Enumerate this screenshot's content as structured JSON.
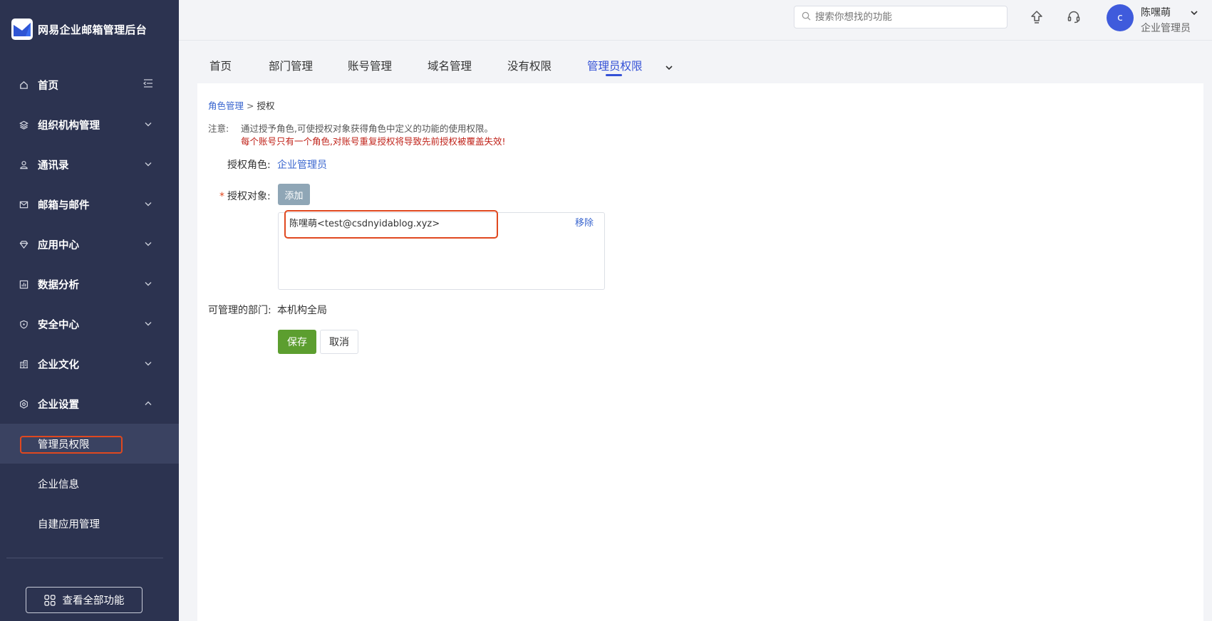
{
  "sidebar": {
    "brand_name": "网易企业邮箱管理后台",
    "items": [
      {
        "label": "首页",
        "icon": "home-icon"
      },
      {
        "label": "组织机构管理",
        "icon": "org-icon"
      },
      {
        "label": "通讯录",
        "icon": "contacts-icon"
      },
      {
        "label": "邮箱与邮件",
        "icon": "mail-icon"
      },
      {
        "label": "应用中心",
        "icon": "app-icon"
      },
      {
        "label": "数据分析",
        "icon": "chart-icon"
      },
      {
        "label": "安全中心",
        "icon": "shield-icon"
      },
      {
        "label": "企业文化",
        "icon": "building-icon"
      },
      {
        "label": "企业设置",
        "icon": "settings-icon"
      }
    ],
    "sub_items": [
      {
        "label": "管理员权限"
      },
      {
        "label": "企业信息"
      },
      {
        "label": "自建应用管理"
      }
    ],
    "view_all_label": "查看全部功能"
  },
  "header": {
    "search_placeholder": "搜索你想找的功能",
    "avatar_letter": "c",
    "user_name": "陈嘿萌",
    "user_role": "企业管理员"
  },
  "tabs": [
    {
      "label": "首页"
    },
    {
      "label": "部门管理"
    },
    {
      "label": "账号管理"
    },
    {
      "label": "域名管理"
    },
    {
      "label": "没有权限"
    },
    {
      "label": "管理员权限"
    }
  ],
  "content": {
    "breadcrumb_parent": "角色管理",
    "breadcrumb_sep": ">",
    "breadcrumb_current": "授权",
    "note_label": "注意:",
    "note_line1": "通过授予角色,可使授权对象获得角色中定义的功能的使用权限。",
    "note_line2": "每个账号只有一个角色,对账号重复授权将导致先前授权被覆盖失效!",
    "role_label": "授权角色:",
    "role_value": "企业管理员",
    "required_mark": "*",
    "target_label": "授权对象:",
    "add_button": "添加",
    "target_entry": "陈嘿萌<test@csdnyidablog.xyz>",
    "remove_label": "移除",
    "dept_label": "可管理的部门:",
    "dept_value": "本机构全局",
    "save_button": "保存",
    "cancel_button": "取消"
  },
  "colors": {
    "sidebar_bg": "#2c3350",
    "accent": "#3451d6",
    "link": "#3a66cf",
    "save_green": "#5c9e2f",
    "warning_red": "#c0231a",
    "highlight": "#e0481f"
  }
}
